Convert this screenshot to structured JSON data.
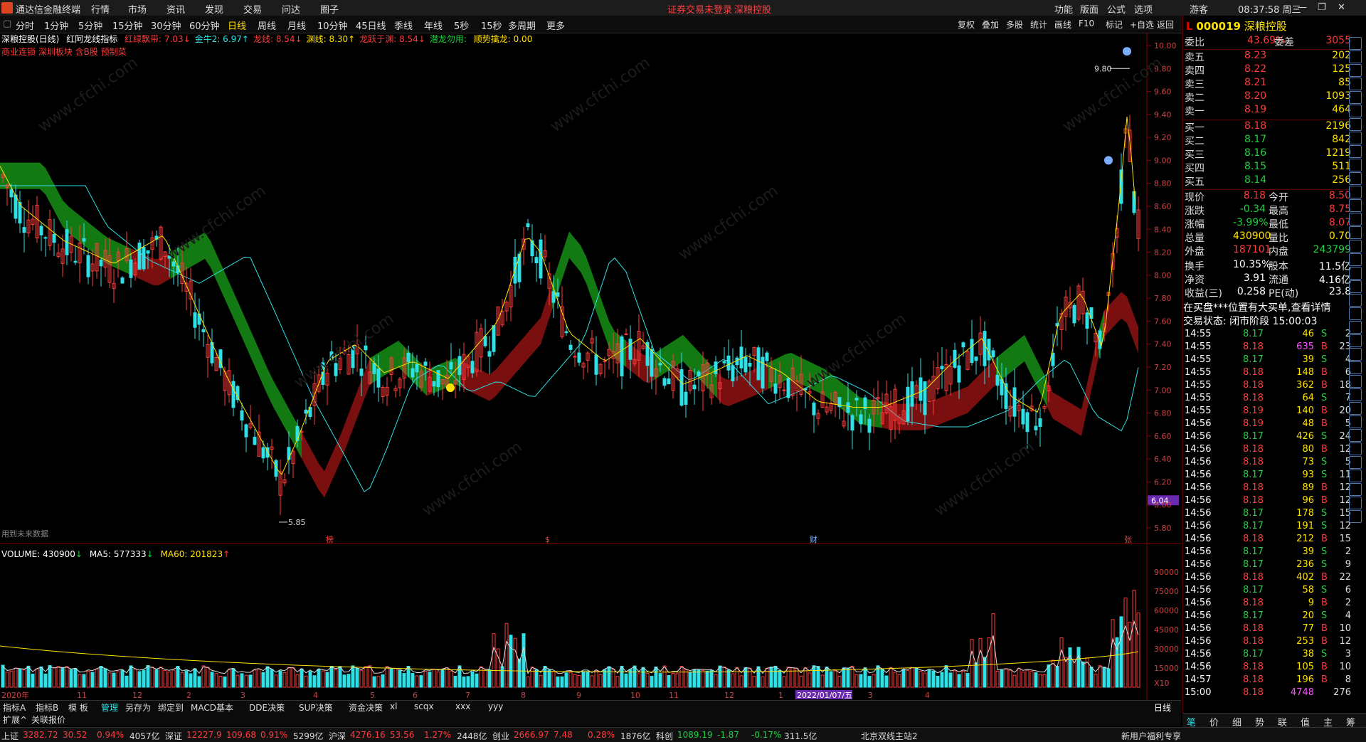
{
  "menubar": {
    "app_title": "通达信金融终端",
    "menus": [
      "行情",
      "市场",
      "资讯",
      "发现",
      "交易",
      "问达",
      "圈子"
    ],
    "notice": "证券交易未登录",
    "stock_name": "深粮控股",
    "right_items": [
      "功能",
      "版面",
      "公式",
      "选项"
    ],
    "guest": "游客",
    "clock": "08:37:58 周三"
  },
  "toolbar": {
    "periods": [
      "分时",
      "1分钟",
      "5分钟",
      "15分钟",
      "30分钟",
      "60分钟",
      "日线",
      "周线",
      "月线",
      "10分钟",
      "45日线",
      "季线",
      "年线",
      "5秒",
      "15秒",
      "多周期",
      "更多"
    ],
    "active_period": "日线",
    "right_buttons": [
      "复权",
      "叠加",
      "多股",
      "统计",
      "画线",
      "F10",
      "标记",
      "+自选",
      "返回"
    ]
  },
  "main_chart": {
    "title": "深粮控股(日线)",
    "indicator_name": "红阿龙线指标",
    "indicator_values": [
      {
        "label": "红绿飘带:",
        "value": "7.03",
        "color": "#ff3b3b",
        "arrow": "↓"
      },
      {
        "label": "金牛2:",
        "value": "6.97",
        "color": "#2fe0e6",
        "arrow": "↑"
      },
      {
        "label": "龙线:",
        "value": "8.54",
        "color": "#ff3b3b",
        "arrow": "↓"
      },
      {
        "label": "渊线:",
        "value": "8.30",
        "color": "#ffe100",
        "arrow": "↑"
      },
      {
        "label": "龙跃于渊:",
        "value": "8.54",
        "color": "#ff3b3b",
        "arrow": "↓"
      },
      {
        "label": "潜龙勿用:",
        "value": "",
        "color": "#20d040",
        "arrow": ""
      },
      {
        "label": "顺势擒龙:",
        "value": "0.00",
        "color": "#ffe100",
        "arrow": ""
      }
    ],
    "sectors_line": "商业连锁  深圳板块  含B股  预制菜",
    "future_data_note": "用到未来数据",
    "price_axis": [
      "10.00",
      "9.80",
      "9.60",
      "9.40",
      "9.20",
      "9.00",
      "8.80",
      "8.60",
      "8.40",
      "8.20",
      "8.00",
      "7.80",
      "7.60",
      "7.40",
      "7.20",
      "7.00",
      "6.80",
      "6.60",
      "6.40",
      "6.20",
      "6.04",
      "6.00",
      "5.80"
    ],
    "current_price_tag": "6.04",
    "high_label": "9.80",
    "low_label": "5.85",
    "event_marks": [
      "榜",
      "$",
      "财",
      "张"
    ]
  },
  "volume_chart": {
    "volume_label": "VOLUME: 430900",
    "ma5_label": "MA5: 577333",
    "ma60_label": "MA60: 201823",
    "axis": [
      "90000",
      "75000",
      "60000",
      "45000",
      "30000",
      "15000",
      "X10"
    ],
    "date_labels": [
      "2020年",
      "11",
      "12",
      "2",
      "3",
      "4",
      "5",
      "6",
      "7",
      "8",
      "9",
      "10",
      "11",
      "12",
      "1",
      "2022/01/07/五",
      "3",
      "4"
    ]
  },
  "chart_data": {
    "type": "candlestick",
    "title": "深粮控股(日线)",
    "ylim": [
      5.8,
      10.0
    ],
    "summary_points": [
      {
        "label": "high",
        "value": 9.8
      },
      {
        "label": "low",
        "value": 5.85
      },
      {
        "label": "close",
        "value": 8.18
      }
    ]
  },
  "bottom_tabs": {
    "row1": [
      "指标A",
      "指标B",
      "模 板",
      "管理",
      "另存为",
      "绑定到",
      "MACD基本",
      "DDE决策",
      "SUP决策",
      "资金决策",
      "xl",
      "scqx",
      "xxx",
      "yyy"
    ],
    "row1_right": "日线",
    "row2": [
      "扩展^",
      "关联报价"
    ]
  },
  "quote": {
    "code": "000019",
    "name": "深粮控股",
    "weibi_label": "委比",
    "weibi": "43.69%",
    "weicha_label": "委差",
    "weicha": "3055",
    "asks": [
      {
        "label": "卖五",
        "price": "8.23",
        "vol": "202"
      },
      {
        "label": "卖四",
        "price": "8.22",
        "vol": "125"
      },
      {
        "label": "卖三",
        "price": "8.21",
        "vol": "85"
      },
      {
        "label": "卖二",
        "price": "8.20",
        "vol": "1093"
      },
      {
        "label": "卖一",
        "price": "8.19",
        "vol": "464"
      }
    ],
    "bids": [
      {
        "label": "买一",
        "price": "8.18",
        "vol": "2196"
      },
      {
        "label": "买二",
        "price": "8.17",
        "vol": "842"
      },
      {
        "label": "买三",
        "price": "8.16",
        "vol": "1219"
      },
      {
        "label": "买四",
        "price": "8.15",
        "vol": "511"
      },
      {
        "label": "买五",
        "price": "8.14",
        "vol": "256"
      }
    ],
    "stats": [
      {
        "l1": "现价",
        "v1": "8.18",
        "c1": "#ff3b3b",
        "l2": "今开",
        "v2": "8.50",
        "c2": "#ff3b3b"
      },
      {
        "l1": "涨跌",
        "v1": "-0.34",
        "c1": "#20d040",
        "l2": "最高",
        "v2": "8.75",
        "c2": "#ff3b3b"
      },
      {
        "l1": "涨幅",
        "v1": "-3.99%",
        "c1": "#20d040",
        "l2": "最低",
        "v2": "8.07",
        "c2": "#ff3b3b"
      },
      {
        "l1": "总量",
        "v1": "430900",
        "c1": "#ffe100",
        "l2": "量比",
        "v2": "0.70",
        "c2": "#ffe100"
      },
      {
        "l1": "外盘",
        "v1": "187101",
        "c1": "#ff3b3b",
        "l2": "内盘",
        "v2": "243799",
        "c2": "#20d040"
      },
      {
        "l1": "换手",
        "v1": "10.35%",
        "c1": "#ffffff",
        "l2": "股本",
        "v2": "11.5亿",
        "c2": "#ffffff"
      },
      {
        "l1": "净资",
        "v1": "3.91",
        "c1": "#ffffff",
        "l2": "流通",
        "v2": "4.16亿",
        "c2": "#ffffff"
      },
      {
        "l1": "收益(三)",
        "v1": "0.258",
        "c1": "#ffffff",
        "l2": "PE(动)",
        "v2": "23.8",
        "c2": "#ffffff"
      }
    ],
    "notice": "在买盘***位置有大买单,查看详情",
    "trade_status": "交易状态: 闭市阶段 15:00:03"
  },
  "ticks": [
    {
      "t": "14:55",
      "p": "8.17",
      "v": "46",
      "s": "S",
      "n": "2"
    },
    {
      "t": "14:55",
      "p": "8.18",
      "v": "635",
      "s": "B",
      "n": "23"
    },
    {
      "t": "14:55",
      "p": "8.17",
      "v": "39",
      "s": "S",
      "n": "4"
    },
    {
      "t": "14:55",
      "p": "8.18",
      "v": "148",
      "s": "B",
      "n": "6"
    },
    {
      "t": "14:55",
      "p": "8.18",
      "v": "362",
      "s": "B",
      "n": "18"
    },
    {
      "t": "14:55",
      "p": "8.18",
      "v": "64",
      "s": "S",
      "n": "7"
    },
    {
      "t": "14:55",
      "p": "8.19",
      "v": "140",
      "s": "B",
      "n": "20"
    },
    {
      "t": "14:56",
      "p": "8.19",
      "v": "48",
      "s": "B",
      "n": "5"
    },
    {
      "t": "14:56",
      "p": "8.17",
      "v": "426",
      "s": "S",
      "n": "24"
    },
    {
      "t": "14:56",
      "p": "8.18",
      "v": "80",
      "s": "B",
      "n": "12"
    },
    {
      "t": "14:56",
      "p": "8.18",
      "v": "73",
      "s": "S",
      "n": "5"
    },
    {
      "t": "14:56",
      "p": "8.17",
      "v": "93",
      "s": "S",
      "n": "11"
    },
    {
      "t": "14:56",
      "p": "8.18",
      "v": "89",
      "s": "B",
      "n": "12"
    },
    {
      "t": "14:56",
      "p": "8.18",
      "v": "96",
      "s": "B",
      "n": "12"
    },
    {
      "t": "14:56",
      "p": "8.17",
      "v": "178",
      "s": "S",
      "n": "15"
    },
    {
      "t": "14:56",
      "p": "8.17",
      "v": "191",
      "s": "S",
      "n": "12"
    },
    {
      "t": "14:56",
      "p": "8.18",
      "v": "212",
      "s": "B",
      "n": "15"
    },
    {
      "t": "14:56",
      "p": "8.17",
      "v": "39",
      "s": "S",
      "n": "2"
    },
    {
      "t": "14:56",
      "p": "8.17",
      "v": "236",
      "s": "S",
      "n": "9"
    },
    {
      "t": "14:56",
      "p": "8.18",
      "v": "402",
      "s": "B",
      "n": "22"
    },
    {
      "t": "14:56",
      "p": "8.17",
      "v": "58",
      "s": "S",
      "n": "6"
    },
    {
      "t": "14:56",
      "p": "8.18",
      "v": "9",
      "s": "B",
      "n": "2"
    },
    {
      "t": "14:56",
      "p": "8.17",
      "v": "20",
      "s": "S",
      "n": "4"
    },
    {
      "t": "14:56",
      "p": "8.18",
      "v": "77",
      "s": "B",
      "n": "10"
    },
    {
      "t": "14:56",
      "p": "8.18",
      "v": "253",
      "s": "B",
      "n": "12"
    },
    {
      "t": "14:56",
      "p": "8.17",
      "v": "38",
      "s": "S",
      "n": "3"
    },
    {
      "t": "14:56",
      "p": "8.18",
      "v": "105",
      "s": "B",
      "n": "10"
    },
    {
      "t": "14:57",
      "p": "8.18",
      "v": "196",
      "s": "B",
      "n": "8"
    },
    {
      "t": "15:00",
      "p": "8.18",
      "v": "4748",
      "s": "",
      "n": "276"
    }
  ],
  "right_tabs": [
    "笔",
    "价",
    "细",
    "势",
    "联",
    "值",
    "主",
    "筹"
  ],
  "statusbar": {
    "items": [
      {
        "label": "上证",
        "value": "3282.72",
        "chg": "30.52",
        "pct": "0.94%",
        "amt": "4057亿",
        "color": "#ff3b3b"
      },
      {
        "label": "深证",
        "value": "12227.9",
        "chg": "109.68",
        "pct": "0.91%",
        "amt": "5299亿",
        "color": "#ff3b3b"
      },
      {
        "label": "沪深",
        "value": "4276.16",
        "chg": "53.56",
        "pct": "1.27%",
        "amt": "2448亿",
        "color": "#ff3b3b"
      },
      {
        "label": "创业",
        "value": "2666.97",
        "chg": "7.48",
        "pct": "0.28%",
        "amt": "1876亿",
        "color": "#ff3b3b"
      },
      {
        "label": "科创",
        "value": "1089.19",
        "chg": "-1.87",
        "pct": "-0.17%",
        "amt": "311.5亿",
        "color": "#20d040"
      }
    ],
    "server": "北京双线主站2",
    "promo": "新用户福利专享"
  }
}
